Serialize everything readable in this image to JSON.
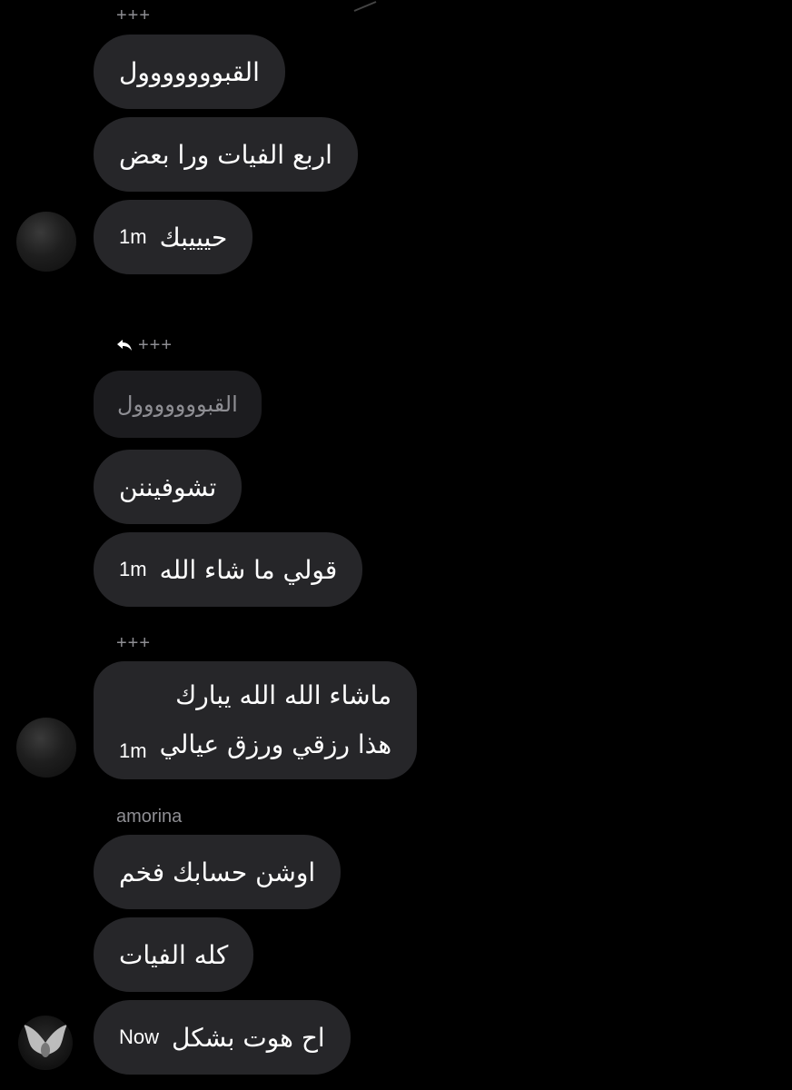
{
  "conversation": {
    "groups": [
      {
        "sender": "+++",
        "messages": [
          {
            "text": "القبووووووول"
          },
          {
            "text": "اربع الفيات ورا بعض"
          },
          {
            "text": "حيييبك",
            "time": "1m"
          }
        ]
      },
      {
        "sender": "+++",
        "reply_quote": "القبووووووول",
        "messages": [
          {
            "text": "تشوفيننن"
          },
          {
            "text": "قولي ما شاء الله",
            "time": "1m"
          }
        ]
      },
      {
        "sender": "+++",
        "messages": [
          {
            "lines": [
              "ماشاء الله الله يبارك",
              "هذا رزقي ورزق عيالي"
            ],
            "time": "1m"
          }
        ]
      },
      {
        "sender": "amorina",
        "messages": [
          {
            "text": "اوشن حسابك فخم"
          },
          {
            "text": "كله الفيات"
          },
          {
            "text": "اح هوت بشكل",
            "time": "Now"
          }
        ]
      }
    ]
  },
  "colors": {
    "background": "#000000",
    "bubble": "#262629",
    "quoted_bubble": "#1c1c1f",
    "secondary_text": "#8e8e93"
  }
}
